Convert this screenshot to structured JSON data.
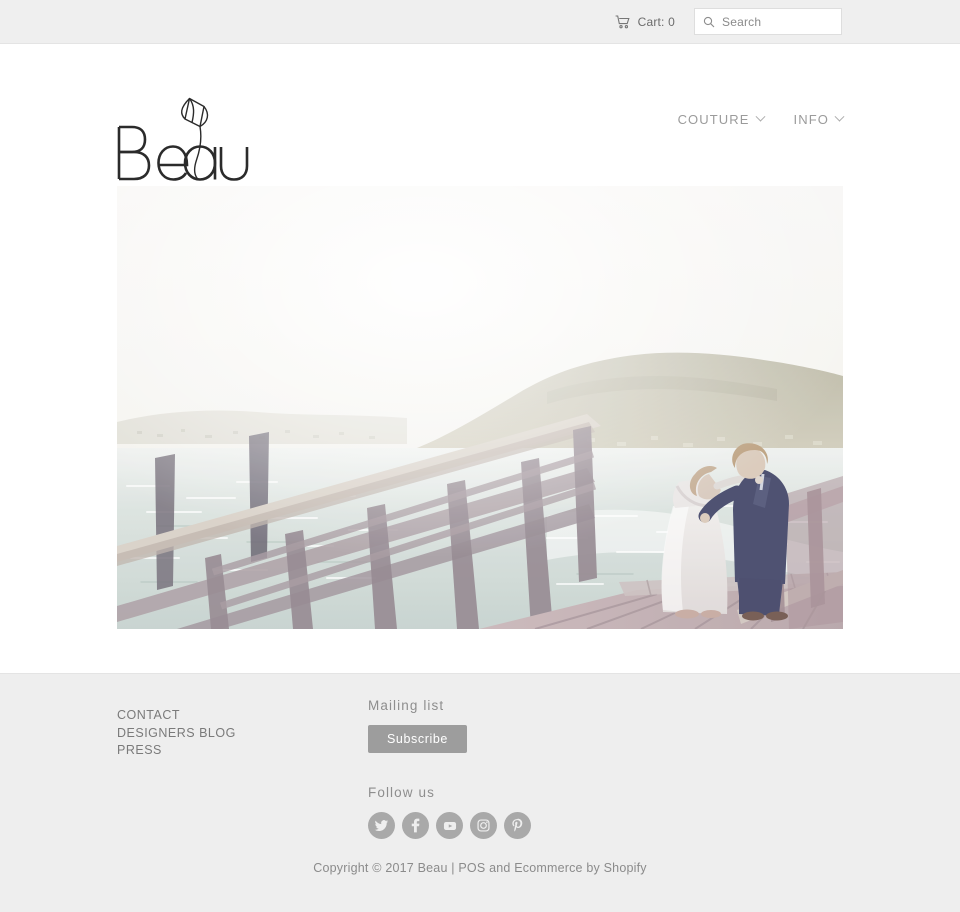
{
  "topbar": {
    "cart_icon": "shopping-cart-icon",
    "cart_label": "Cart: 0",
    "search_icon": "search-icon",
    "search_value": "",
    "search_placeholder": "Search"
  },
  "header": {
    "logo_text": "Beau",
    "logo_mark": "tulip-flower-icon",
    "nav": [
      {
        "label": "COUTURE",
        "has_dropdown": true,
        "caret_icon": "chevron-down-icon"
      },
      {
        "label": "INFO",
        "has_dropdown": true,
        "caret_icon": "chevron-down-icon"
      }
    ]
  },
  "hero": {
    "alt": "Bride and groom kissing on a wooden jetty over water with hills behind",
    "colors": {
      "sky": "#f6f5f2",
      "hill": "#b3b09d",
      "water": "#cfd8d3",
      "wood": "#b9a9ac",
      "suit": "#3b3f63",
      "dress": "#e3dfe0"
    }
  },
  "footer": {
    "links": [
      {
        "label": "CONTACT"
      },
      {
        "label": "DESIGNERS BLOG"
      },
      {
        "label": "PRESS"
      }
    ],
    "mailing_heading": "Mailing list",
    "subscribe_label": "Subscribe",
    "follow_heading": "Follow us",
    "social": [
      {
        "name": "twitter-icon"
      },
      {
        "name": "facebook-icon"
      },
      {
        "name": "youtube-icon"
      },
      {
        "name": "instagram-icon"
      },
      {
        "name": "pinterest-icon"
      }
    ],
    "copyright_prefix": "Copyright © 2017 Beau | ",
    "copyright_pos": "POS",
    "copyright_mid": " and ",
    "copyright_ecommerce": "Ecommerce",
    "copyright_suffix": " by Shopify"
  },
  "colors": {
    "topbar_bg": "#efefef",
    "footer_bg": "#eeeeee",
    "text": "#7a7a7a",
    "button": "#9d9d9d",
    "social": "#a9a9a9"
  }
}
